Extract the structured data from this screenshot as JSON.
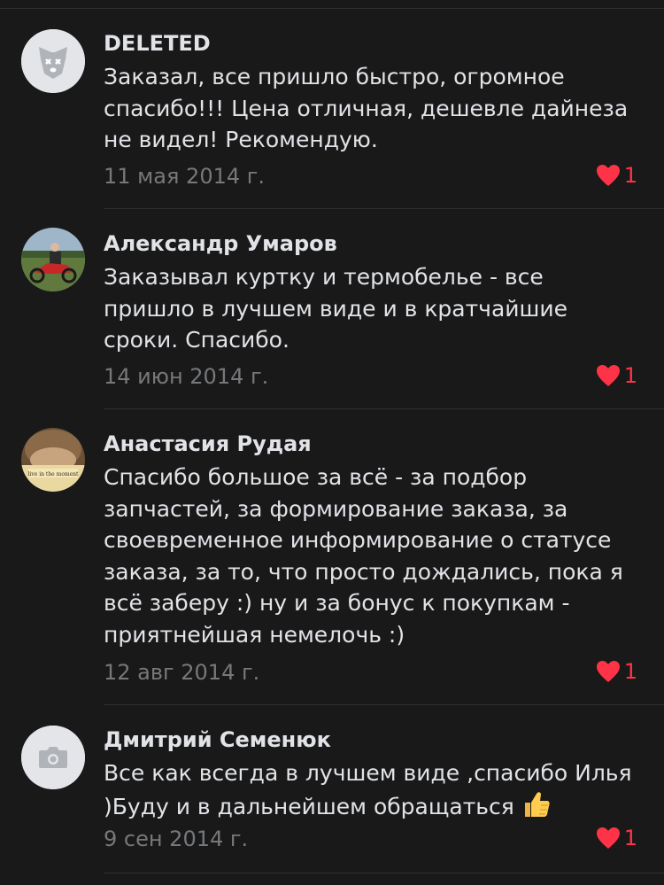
{
  "comments": [
    {
      "author": "DELETED",
      "text": "Заказал, все пришло быстро, огромное спасибо!!! Цена отличная, дешевле дайнеза не видел! Рекомендую.",
      "date": "11 мая 2014 г.",
      "likes": "1",
      "avatar_icon": "deleted-dog-icon"
    },
    {
      "author": "Александр Умаров",
      "text": "Заказывал куртку и термобелье - все пришло в лучшем виде и в кратчайшие сроки. Спасибо.",
      "date": "14 июн 2014 г.",
      "likes": "1",
      "avatar_icon": "user-photo-motorcycle"
    },
    {
      "author": "Анастасия Рудая",
      "text": "Спасибо большое за всё - за подбор запчастей, за формирование заказа, за своевременное информирование о статусе заказа, за то, что просто дождались, пока я всё заберу :) ну и за бонус к покупкам - приятнейшая немелочь :)",
      "date": "12 авг 2014 г.",
      "likes": "1",
      "avatar_icon": "user-photo"
    },
    {
      "author": "Дмитрий Семенюк",
      "text": "Все как всегда в лучшем виде ,спасибо Илья )Буду и в дальнейшем обращаться",
      "date": "9 сен 2014 г.",
      "likes": "1",
      "avatar_icon": "camera-placeholder-icon"
    }
  ],
  "colors": {
    "background": "#19191a",
    "text": "#e1e3e6",
    "secondary": "#76787a",
    "like": "#ff3347",
    "divider": "#2e2f31"
  }
}
